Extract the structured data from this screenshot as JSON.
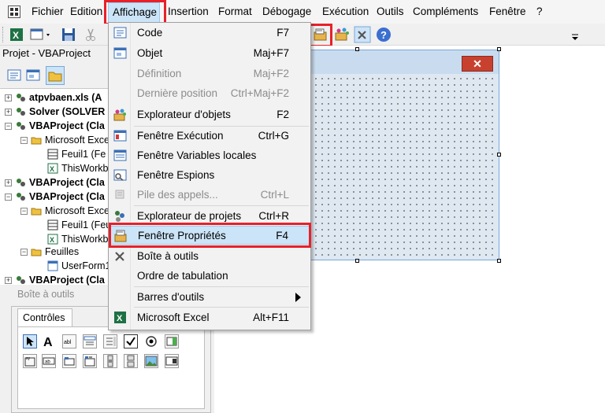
{
  "menubar": {
    "items": [
      "Fichier",
      "Edition",
      "Affichage",
      "Insertion",
      "Format",
      "Débogage",
      "Exécution",
      "Outils",
      "Compléments",
      "Fenêtre",
      "?"
    ]
  },
  "project": {
    "title": "Projet - VBAProject",
    "tree": [
      "atpvbaen.xls (A",
      "Solver (SOLVER",
      "VBAProject (Cla",
      "Microsoft Excel",
      "Feuil1 (Fe",
      "ThisWorkb",
      "VBAProject (Cla",
      "VBAProject (Cla",
      "Microsoft Excel",
      "Feuil1 (Feu",
      "ThisWorkb",
      "Feuilles",
      "UserForm1",
      "VBAProject (Cla"
    ]
  },
  "toolbox": {
    "title": "Boîte à outils",
    "tab": "Contrôles",
    "row1_icons": [
      "pointer-icon",
      "label-icon",
      "textbox-icon",
      "combobox-icon",
      "listbox-icon",
      "checkbox-icon",
      "optionbutton-icon",
      "togglebutton-icon"
    ],
    "row2_icons": [
      "frame-icon",
      "commandbutton-icon",
      "tabstrip-icon",
      "multipage-icon",
      "scrollbar-icon",
      "spinbutton-icon",
      "image-icon",
      "refedit-icon"
    ]
  },
  "view_menu": {
    "items": [
      {
        "label": "Code",
        "shortcut": "F7",
        "disabled": false
      },
      {
        "label": "Objet",
        "shortcut": "Maj+F7",
        "disabled": false
      },
      {
        "label": "Définition",
        "shortcut": "Maj+F2",
        "disabled": true
      },
      {
        "label": "Dernière position",
        "shortcut": "Ctrl+Maj+F2",
        "disabled": true
      },
      {
        "label": "Explorateur d'objets",
        "shortcut": "F2",
        "disabled": false
      },
      {
        "label": "Fenêtre Exécution",
        "shortcut": "Ctrl+G",
        "disabled": false
      },
      {
        "label": "Fenêtre Variables locales",
        "shortcut": "",
        "disabled": false
      },
      {
        "label": "Fenêtre Espions",
        "shortcut": "",
        "disabled": false
      },
      {
        "label": "Pile des appels...",
        "shortcut": "Ctrl+L",
        "disabled": true
      },
      {
        "label": "Explorateur de projets",
        "shortcut": "Ctrl+R",
        "disabled": false
      },
      {
        "label": "Fenêtre Propriétés",
        "shortcut": "F4",
        "disabled": false
      },
      {
        "label": "Boîte à outils",
        "shortcut": "",
        "disabled": false
      },
      {
        "label": "Ordre de tabulation",
        "shortcut": "",
        "disabled": false
      },
      {
        "label": "Barres d'outils",
        "shortcut": "",
        "disabled": false
      },
      {
        "label": "Microsoft Excel",
        "shortcut": "Alt+F11",
        "disabled": false
      }
    ],
    "selected": "Fenêtre Propriétés"
  },
  "highlight_color": "#e8202a"
}
